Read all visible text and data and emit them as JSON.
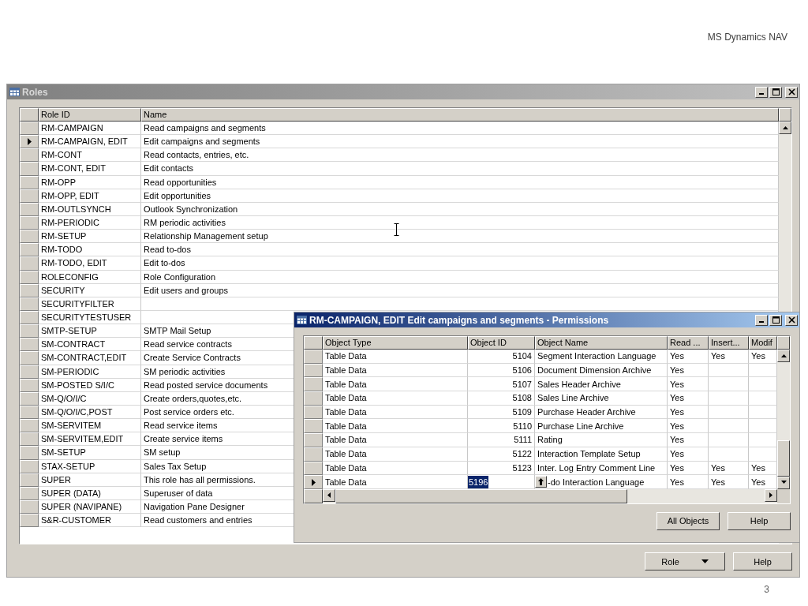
{
  "slide": {
    "header": "MS Dynamics NAV",
    "page_number": "3"
  },
  "roles_window": {
    "title": "Roles",
    "active": false,
    "columns": [
      "Role ID",
      "Name"
    ],
    "rows": [
      {
        "role_id": "RM-CAMPAIGN",
        "name": "Read campaigns and segments",
        "selected": false
      },
      {
        "role_id": "RM-CAMPAIGN, EDIT",
        "name": "Edit campaigns and segments",
        "selected": true
      },
      {
        "role_id": "RM-CONT",
        "name": "Read contacts, entries, etc.",
        "selected": false
      },
      {
        "role_id": "RM-CONT, EDIT",
        "name": "Edit contacts",
        "selected": false
      },
      {
        "role_id": "RM-OPP",
        "name": "Read opportunities",
        "selected": false
      },
      {
        "role_id": "RM-OPP, EDIT",
        "name": "Edit opportunities",
        "selected": false
      },
      {
        "role_id": "RM-OUTLSYNCH",
        "name": "Outlook Synchronization",
        "selected": false
      },
      {
        "role_id": "RM-PERIODIC",
        "name": "RM periodic activities",
        "selected": false
      },
      {
        "role_id": "RM-SETUP",
        "name": "Relationship Management setup",
        "selected": false
      },
      {
        "role_id": "RM-TODO",
        "name": "Read to-dos",
        "selected": false
      },
      {
        "role_id": "RM-TODO, EDIT",
        "name": "Edit to-dos",
        "selected": false
      },
      {
        "role_id": "ROLECONFIG",
        "name": "Role Configuration",
        "selected": false
      },
      {
        "role_id": "SECURITY",
        "name": "Edit users and groups",
        "selected": false
      },
      {
        "role_id": "SECURITYFILTER",
        "selected": false
      },
      {
        "role_id": "SECURITYTESTUSER",
        "selected": false
      },
      {
        "role_id": "SMTP-SETUP",
        "name": "SMTP Mail Setup",
        "selected": false
      },
      {
        "role_id": "SM-CONTRACT",
        "name": "Read service contracts",
        "selected": false
      },
      {
        "role_id": "SM-CONTRACT,EDIT",
        "name": "Create Service Contracts",
        "selected": false
      },
      {
        "role_id": "SM-PERIODIC",
        "name": "SM periodic activities",
        "selected": false
      },
      {
        "role_id": "SM-POSTED S/I/C",
        "name": "Read posted service documents",
        "selected": false
      },
      {
        "role_id": "SM-Q/O/I/C",
        "name": "Create orders,quotes,etc.",
        "selected": false
      },
      {
        "role_id": "SM-Q/O/I/C,POST",
        "name": "Post service orders etc.",
        "selected": false
      },
      {
        "role_id": "SM-SERVITEM",
        "name": "Read service items",
        "selected": false
      },
      {
        "role_id": "SM-SERVITEM,EDIT",
        "name": "Create service items",
        "selected": false
      },
      {
        "role_id": "SM-SETUP",
        "name": "SM setup",
        "selected": false
      },
      {
        "role_id": "STAX-SETUP",
        "name": "Sales Tax Setup",
        "selected": false
      },
      {
        "role_id": "SUPER",
        "name": "This role has all permissions.",
        "selected": false
      },
      {
        "role_id": "SUPER (DATA)",
        "name": "Superuser of data",
        "selected": false
      },
      {
        "role_id": "SUPER (NAVIPANE)",
        "name": "Navigation Pane Designer",
        "selected": false
      },
      {
        "role_id": "S&R-CUSTOMER",
        "name": "Read customers and entries",
        "selected": false
      }
    ],
    "buttons": [
      {
        "label": "Role",
        "kind": "menu"
      },
      {
        "label": "Help",
        "kind": "plain"
      }
    ]
  },
  "permissions_window": {
    "title": "RM-CAMPAIGN, EDIT Edit campaigns and segments - Permissions",
    "active": true,
    "columns": [
      "Object Type",
      "Object ID",
      "Object Name",
      "Read ...",
      "Insert...",
      "Modif"
    ],
    "rows": [
      {
        "object_type": "Table Data",
        "object_id": "5104",
        "object_name": "Segment Interaction Language",
        "read": "Yes",
        "insert": "Yes",
        "modify": "Yes",
        "selected": false,
        "editing": false
      },
      {
        "object_type": "Table Data",
        "object_id": "5106",
        "object_name": "Document Dimension Archive",
        "read": "Yes",
        "selected": false,
        "editing": false
      },
      {
        "object_type": "Table Data",
        "object_id": "5107",
        "object_name": "Sales Header Archive",
        "read": "Yes",
        "selected": false,
        "editing": false
      },
      {
        "object_type": "Table Data",
        "object_id": "5108",
        "object_name": "Sales Line Archive",
        "read": "Yes",
        "selected": false,
        "editing": false
      },
      {
        "object_type": "Table Data",
        "object_id": "5109",
        "object_name": "Purchase Header Archive",
        "read": "Yes",
        "selected": false,
        "editing": false
      },
      {
        "object_type": "Table Data",
        "object_id": "5110",
        "object_name": "Purchase Line Archive",
        "read": "Yes",
        "selected": false,
        "editing": false
      },
      {
        "object_type": "Table Data",
        "object_id": "5111",
        "object_name": "Rating",
        "read": "Yes",
        "selected": false,
        "editing": false
      },
      {
        "object_type": "Table Data",
        "object_id": "5122",
        "object_name": "Interaction Template Setup",
        "read": "Yes",
        "selected": false,
        "editing": false
      },
      {
        "object_type": "Table Data",
        "object_id": "5123",
        "object_name": "Inter. Log Entry Comment Line",
        "read": "Yes",
        "insert": "Yes",
        "modify": "Yes",
        "selected": false,
        "editing": false
      },
      {
        "object_type": "Table Data",
        "object_id": "5196",
        "object_name": "-do Interaction Language",
        "read": "Yes",
        "insert": "Yes",
        "modify": "Yes",
        "selected": true,
        "editing": true
      }
    ],
    "buttons": [
      {
        "label": "All Objects",
        "kind": "plain"
      },
      {
        "label": "Help",
        "kind": "plain"
      }
    ]
  }
}
